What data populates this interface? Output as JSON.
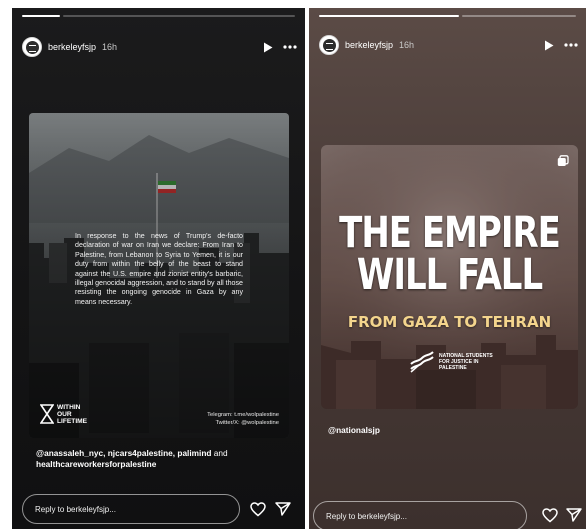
{
  "left_story": {
    "username": "berkeleyfsjp",
    "timestamp": "16h",
    "body_text": "In response to the news of Trump's de-facto declaration of war on Iran we declare: From Iran to Palestine, from Lebanon to Syria to Yemen, it is our duty from within the belly of the beast to stand against the U.S. empire and zionist entity's barbaric, illegal genocidal aggression, and to stand by all those resisting the ongoing genocide in Gaza by any means necessary.",
    "brand_line1": "WITHIN",
    "brand_line2": "OUR",
    "brand_line3": "LIFETIME",
    "credit_telegram": "Telegram: t.me/wolpalestine",
    "credit_twitter": "Twitter/X: @wolpalestine",
    "mentions": "@anassaleh_nyc, njcars4palestine, palimind",
    "mentions_and": " and",
    "mentions_last": "healthcareworkersforpalestine",
    "reply_placeholder": "Reply to berkeleyfsjp..."
  },
  "right_story": {
    "username": "berkeleyfsjp",
    "timestamp": "16h",
    "headline_line1": "THE EMPIRE",
    "headline_line2": "WILL FALL",
    "subheadline": "FROM GAZA TO TEHRAN",
    "org_line1": "NATIONAL STUDENTS",
    "org_line2": "FOR JUSTICE IN PALESTINE",
    "mention": "@nationalsjp",
    "reply_placeholder": "Reply to berkeleyfsjp..."
  },
  "icons": {
    "play": "play-icon",
    "more": "more-options-icon",
    "like": "heart-icon",
    "share": "send-icon",
    "multi": "carousel-icon"
  },
  "colors": {
    "subheadline": "#f4d58d"
  }
}
